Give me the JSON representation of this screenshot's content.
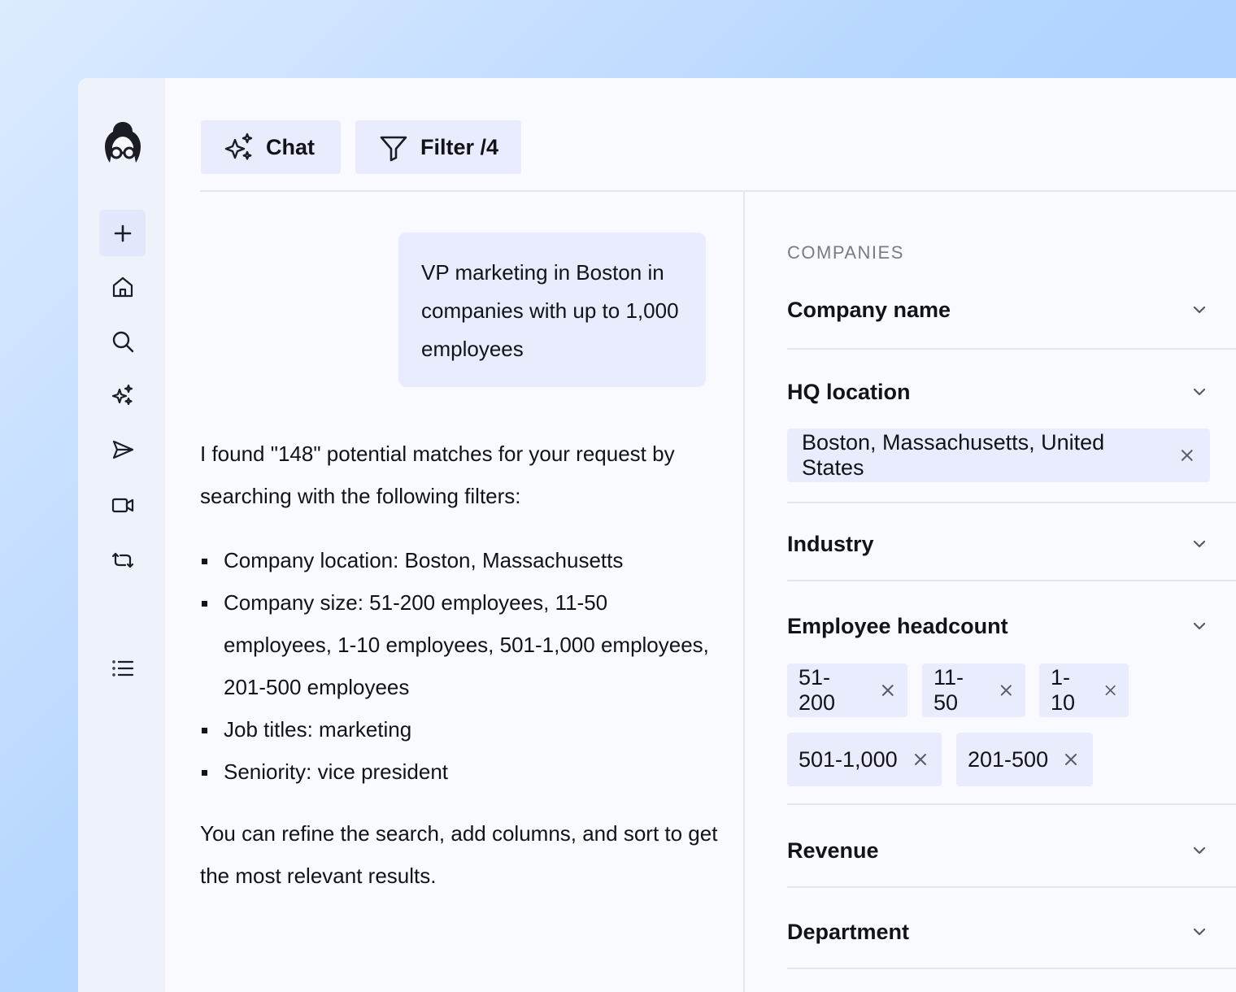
{
  "toolbar": {
    "chat_label": "Chat",
    "filter_label": "Filter /4"
  },
  "sidebar": {
    "items": [
      {
        "icon": "plus-icon",
        "active": true
      },
      {
        "icon": "home-icon"
      },
      {
        "icon": "search-icon"
      },
      {
        "icon": "sparkles-icon"
      },
      {
        "icon": "send-icon"
      },
      {
        "icon": "video-icon"
      },
      {
        "icon": "repeat-icon"
      },
      {
        "icon": "list-icon"
      }
    ]
  },
  "chat": {
    "user_message": "VP marketing in Boston in companies with up to 1,000 employees",
    "reply_intro": "I found \"148\" potential matches for your request by searching with the following filters:",
    "bullets": [
      "Company location: Boston, Massachusetts",
      "Company size: 51-200 employees, 11-50 employees, 1-10 employees, 501-1,000 employees, 201-500 employees",
      "Job titles: marketing",
      "Seniority: vice president"
    ],
    "reply_closing": "You can refine the search, add columns, and sort to get the most relevant results."
  },
  "filters": {
    "section_label": "COMPANIES",
    "company_name": "Company name",
    "hq_location": "HQ location",
    "hq_value": "Boston, Massachusetts, United States",
    "industry": "Industry",
    "employee_headcount": "Employee headcount",
    "headcount_chips": [
      "51-200",
      "11-50",
      "1-10",
      "501-1,000",
      "201-500"
    ],
    "revenue": "Revenue",
    "department": "Department"
  },
  "colors": {
    "chip_bg": "#e8ecfc",
    "rail_bg": "#eef2fb",
    "panel_bg": "#f8faff"
  }
}
